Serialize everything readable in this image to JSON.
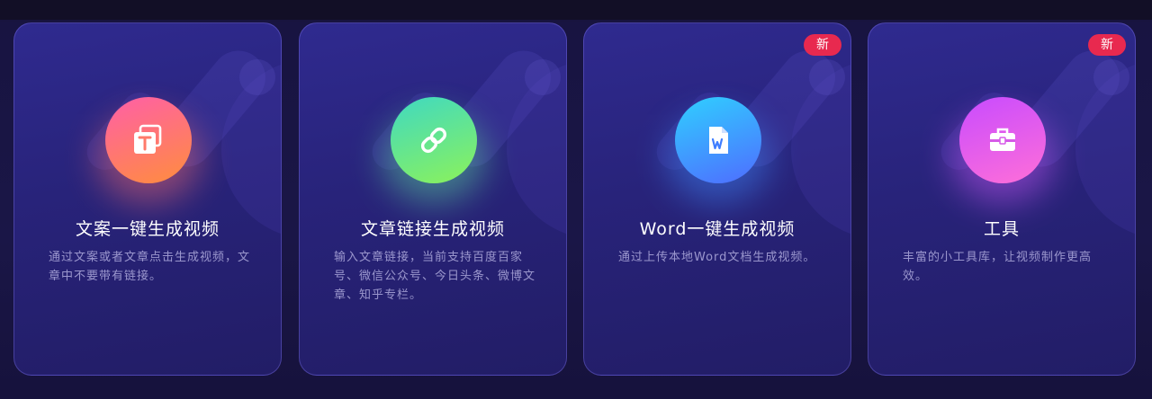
{
  "cards": [
    {
      "title": "文案一键生成视频",
      "description": "通过文案或者文章点击生成视频，文章中不要带有链接。",
      "icon": "text-t-icon",
      "gradient": [
        "#ff5fa8",
        "#ff8d3d"
      ],
      "badge": ""
    },
    {
      "title": "文章链接生成视频",
      "description": "输入文章链接，当前支持百度百家号、微信公众号、今日头条、微博文章、知乎专栏。",
      "icon": "link-icon",
      "gradient": [
        "#3fd9c2",
        "#8cf25a"
      ],
      "badge": ""
    },
    {
      "title": "Word一键生成视频",
      "description": "通过上传本地Word文档生成视频。",
      "icon": "word-document-icon",
      "gradient": [
        "#2fd0ff",
        "#4f6cff"
      ],
      "badge": "新"
    },
    {
      "title": "工具",
      "description": "丰富的小工具库，让视频制作更高效。",
      "icon": "toolbox-icon",
      "gradient": [
        "#c84bff",
        "#ff6fd8"
      ],
      "badge": "新"
    }
  ],
  "colors": {
    "background": "#17133a",
    "card": "#2b2685",
    "badge": "#e8294f"
  }
}
